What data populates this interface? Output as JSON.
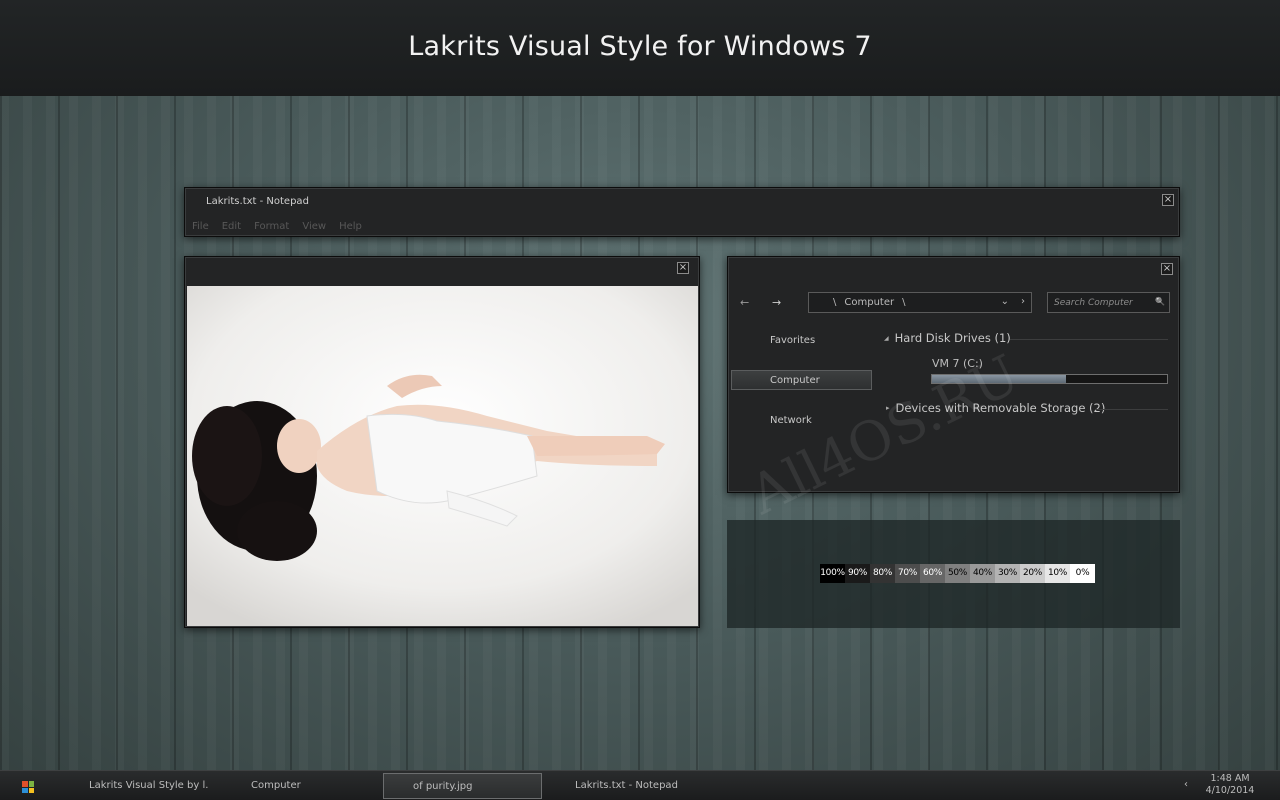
{
  "banner": {
    "title": "Lakrits Visual Style for Windows 7"
  },
  "notepad": {
    "title": "Lakrits.txt - Notepad",
    "menu": [
      "File",
      "Edit",
      "Format",
      "View",
      "Help"
    ],
    "close": "×"
  },
  "photo_window": {
    "close": "×"
  },
  "explorer": {
    "close": "×",
    "back": "←",
    "forward": "→",
    "address": {
      "sep1": "\\",
      "location": "Computer",
      "sep2": "\\",
      "dropdown": "⌄",
      "go": "›"
    },
    "search": {
      "placeholder": "Search Computer",
      "icon": "🔍"
    },
    "nav": {
      "favorites": "Favorites",
      "computer": "Computer",
      "network": "Network"
    },
    "groups": {
      "hard_disks": {
        "arrow": "◢",
        "label": "Hard Disk Drives (1)"
      },
      "removable": {
        "arrow": "▸",
        "label": "Devices with Removable Storage (2)"
      }
    },
    "drive": {
      "label": "VM 7 (C:)",
      "used_fraction": 0.57
    }
  },
  "swatches": [
    {
      "label": "100%",
      "bg": "#000000",
      "fg": "#ffffff"
    },
    {
      "label": "90%",
      "bg": "#1a1a1a",
      "fg": "#ffffff"
    },
    {
      "label": "80%",
      "bg": "#333333",
      "fg": "#ffffff"
    },
    {
      "label": "70%",
      "bg": "#4d4d4d",
      "fg": "#ffffff"
    },
    {
      "label": "60%",
      "bg": "#666666",
      "fg": "#ffffff"
    },
    {
      "label": "50%",
      "bg": "#808080",
      "fg": "#000000"
    },
    {
      "label": "40%",
      "bg": "#999999",
      "fg": "#000000"
    },
    {
      "label": "30%",
      "bg": "#b3b3b3",
      "fg": "#000000"
    },
    {
      "label": "20%",
      "bg": "#cccccc",
      "fg": "#000000"
    },
    {
      "label": "10%",
      "bg": "#e6e6e6",
      "fg": "#000000"
    },
    {
      "label": "0%",
      "bg": "#ffffff",
      "fg": "#000000"
    }
  ],
  "watermark": "All4OS.RU",
  "taskbar": {
    "items": [
      "Lakrits Visual Style by l...",
      "Computer",
      "of purity.jpg",
      "Lakrits.txt - Notepad"
    ],
    "tray_arrow": "‹",
    "time": "1:48 AM",
    "date": "4/10/2014"
  },
  "colors": {
    "accent_bar": "#6b7682",
    "window_bg": "#232425",
    "taskbar_bg": "#1b1c1d"
  }
}
